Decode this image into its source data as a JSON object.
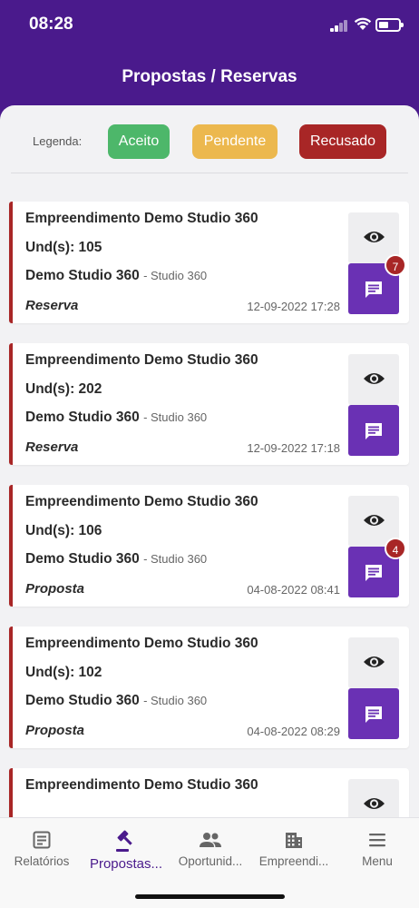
{
  "status": {
    "time": "08:28"
  },
  "header": {
    "title": "Propostas / Reservas"
  },
  "legend": {
    "label": "Legenda:",
    "items": [
      {
        "label": "Aceito",
        "color": "#4db76a"
      },
      {
        "label": "Pendente",
        "color": "#ecb84e"
      },
      {
        "label": "Recusado",
        "color": "#a82626"
      }
    ]
  },
  "cards": [
    {
      "empreendimento": "Empreendimento Demo Studio 360",
      "units": "Und(s): 105",
      "name": "Demo Studio 360",
      "sub": "- Studio 360",
      "kind": "Reserva",
      "date": "12-09-2022 17:28",
      "badge": "7"
    },
    {
      "empreendimento": "Empreendimento Demo Studio 360",
      "units": "Und(s): 202",
      "name": "Demo Studio 360",
      "sub": "- Studio 360",
      "kind": "Reserva",
      "date": "12-09-2022 17:18",
      "badge": ""
    },
    {
      "empreendimento": "Empreendimento Demo Studio 360",
      "units": "Und(s): 106",
      "name": "Demo Studio 360",
      "sub": "- Studio 360",
      "kind": "Proposta",
      "date": "04-08-2022 08:41",
      "badge": "4"
    },
    {
      "empreendimento": "Empreendimento Demo Studio 360",
      "units": "Und(s): 102",
      "name": "Demo Studio 360",
      "sub": "- Studio 360",
      "kind": "Proposta",
      "date": "04-08-2022 08:29",
      "badge": ""
    },
    {
      "empreendimento": "Empreendimento Demo Studio 360",
      "units": "",
      "name": "",
      "sub": "",
      "kind": "",
      "date": "",
      "badge": ""
    }
  ],
  "tabs": [
    {
      "label": "Relatórios",
      "icon": "report-icon"
    },
    {
      "label": "Propostas...",
      "icon": "gavel-icon",
      "active": true
    },
    {
      "label": "Oportunid...",
      "icon": "people-icon"
    },
    {
      "label": "Empreendi...",
      "icon": "building-icon"
    },
    {
      "label": "Menu",
      "icon": "menu-icon"
    }
  ],
  "colors": {
    "brand": "#4a1a8c",
    "accent": "#6a31b4",
    "refused": "#a82626"
  }
}
